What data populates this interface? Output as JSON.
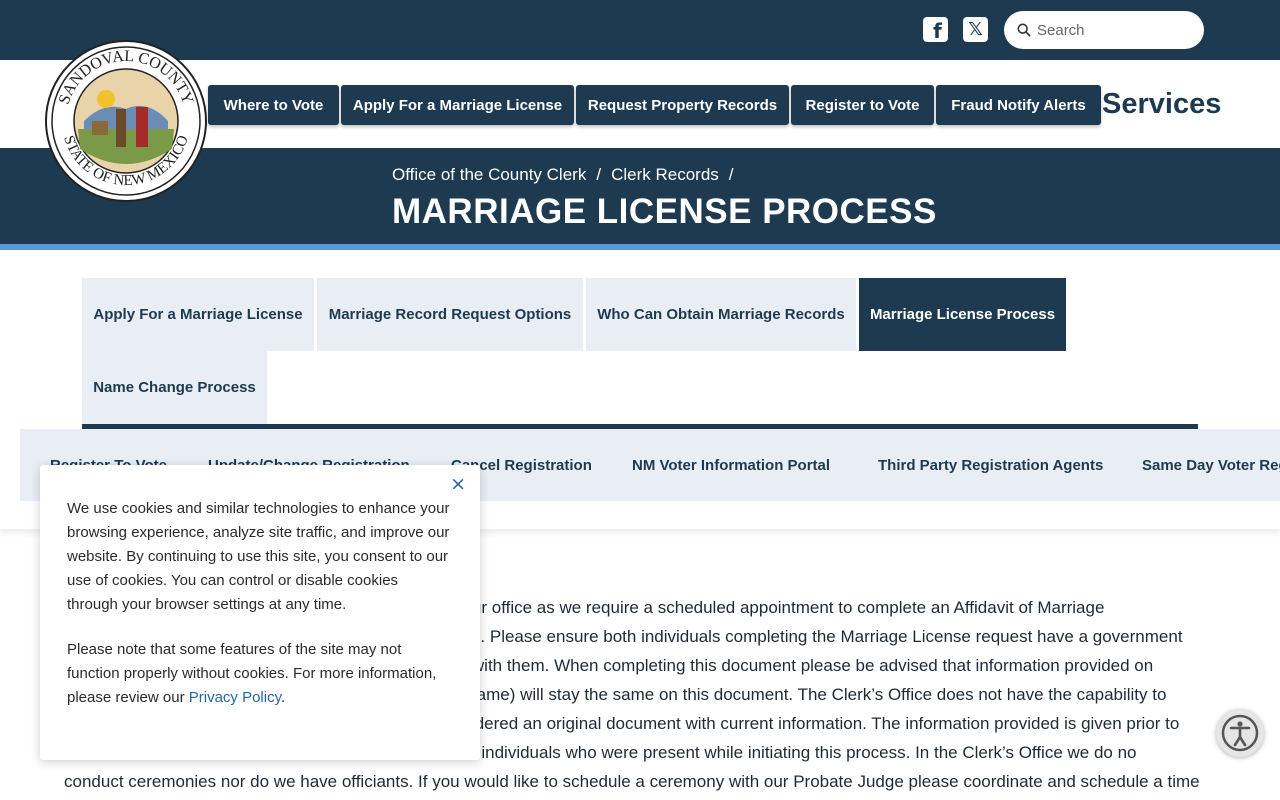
{
  "header": {
    "social": {
      "facebook_icon": "facebook-icon",
      "x_icon": "x-icon"
    },
    "search": {
      "placeholder": "Search"
    }
  },
  "logo": {
    "text_top": "SANDOVAL COUNTY",
    "text_bottom": "STATE OF NEW MEXICO"
  },
  "nav": {
    "items": [
      {
        "label": "Where to Vote"
      },
      {
        "label": "Apply For a Marriage License"
      },
      {
        "label": "Request Property Records"
      },
      {
        "label": "Register to Vote"
      },
      {
        "label": "Fraud Notify Alerts"
      }
    ],
    "services_label": "Services"
  },
  "breadcrumb": {
    "items": [
      "Office of the County Clerk",
      "Clerk Records"
    ],
    "separator": "/"
  },
  "page_title": "MARRIAGE LICENSE PROCESS",
  "tabs": [
    {
      "label": "Apply For a Marriage License"
    },
    {
      "label": "Marriage Record Request Options"
    },
    {
      "label": "Who Can Obtain Marriage Records"
    },
    {
      "label": "Marriage License Process",
      "active": true
    },
    {
      "label": "Name Change Process"
    }
  ],
  "subnav": {
    "items": [
      {
        "label": "Register To Vote"
      },
      {
        "label": "Update/Change Registration"
      },
      {
        "label": "Cancel Registration"
      },
      {
        "label": "NM Voter Information Portal"
      },
      {
        "label": "Third Party Registration Agents"
      },
      {
        "label": "Same Day Voter Registration"
      }
    ]
  },
  "content": {
    "lines": [
      "t our office as we require a scheduled appointment to complete an Affidavit of Marriage",
      "nse. Please ensure both individuals completing the Marriage License request have a government",
      "rs with them. When completing this document please be advised that information provided on",
      "n name) will stay the same on this document. The Clerk’s Office does not have the capability to",
      "nsidered an original document with current information. The information provided is given prior to",
      "the individuals who were present while initiating this process. In the Clerk’s Office we do no",
      "conduct ceremonies nor do we have officiants. If you would like to schedule a ceremony with our Probate Judge please coordinate and schedule a time"
    ]
  },
  "cookie_banner": {
    "paragraph_1": "We use cookies and similar technologies to enhance your browsing experience, analyze site traffic, and improve our website. By continuing to use this site, you consent to our use of cookies. You can control or disable cookies through your browser settings at any time.",
    "paragraph_2_prefix": "Please note that some features of the site may not function properly without cookies. For more information, please review our ",
    "privacy_link": "Privacy Policy",
    "paragraph_2_suffix": ".",
    "close_label": "×"
  },
  "accessibility": {
    "icon": "accessibility-icon"
  },
  "colors": {
    "brand": "#1d3a50",
    "accent": "#5b9bd5",
    "tab_bg": "#e9eef5",
    "link": "#2366a8"
  }
}
